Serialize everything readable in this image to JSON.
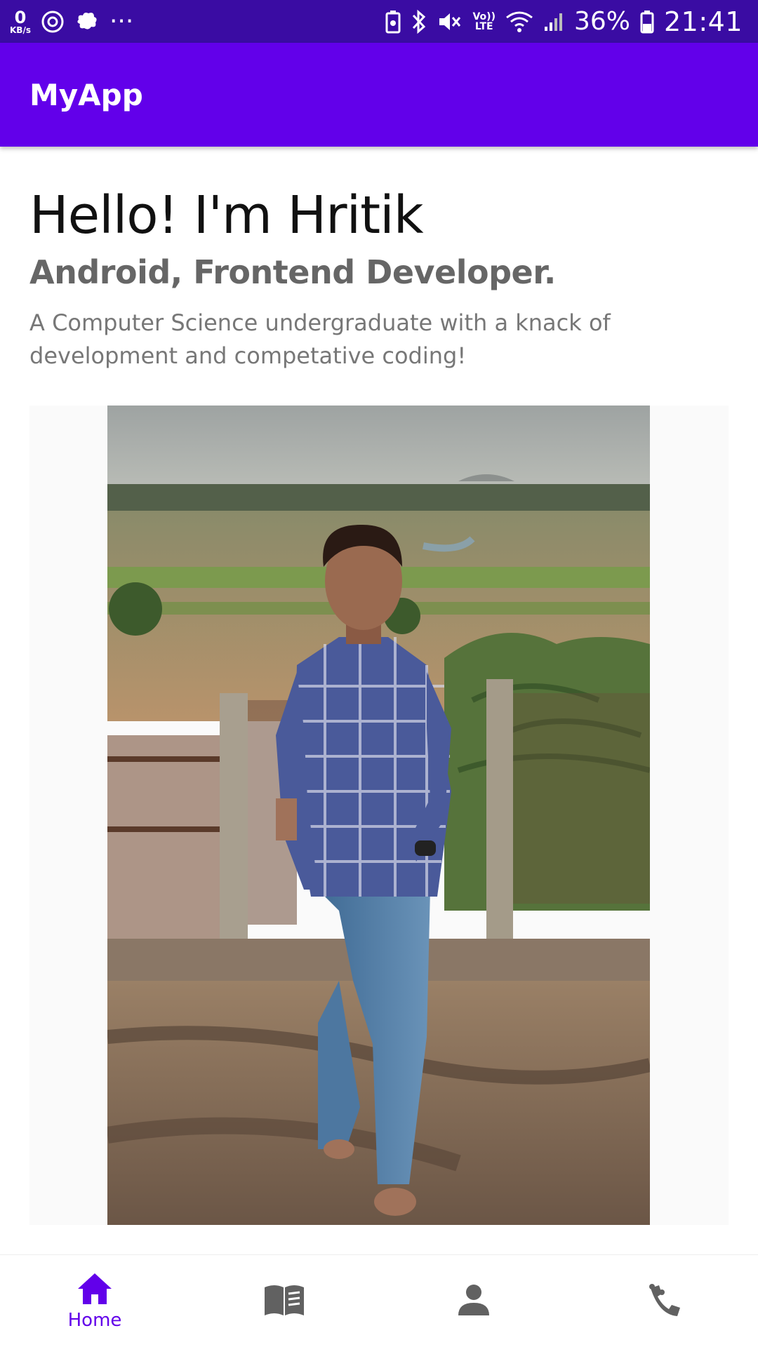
{
  "status_bar": {
    "net_speed_value": "0",
    "net_speed_unit": "KB/s",
    "overflow": "···",
    "volte_top": "Vo))",
    "volte_bottom": "LTE",
    "battery": "36%",
    "time": "21:41"
  },
  "app_bar": {
    "title": "MyApp"
  },
  "profile": {
    "greeting": "Hello! I'm Hritik",
    "role": "Android, Frontend Developer.",
    "bio": "A Computer Science undergraduate with a knack of development and competative coding!"
  },
  "bottom_nav": {
    "items": [
      {
        "label": "Home",
        "icon": "home-icon",
        "selected": true
      },
      {
        "label": "",
        "icon": "book-icon",
        "selected": false
      },
      {
        "label": "",
        "icon": "person-icon",
        "selected": false
      },
      {
        "label": "",
        "icon": "contact-icon",
        "selected": false
      }
    ]
  },
  "colors": {
    "status_bar": "#3a0ca3",
    "app_bar": "#6200ea",
    "accent": "#6200ea",
    "inactive_icon": "#616161"
  }
}
